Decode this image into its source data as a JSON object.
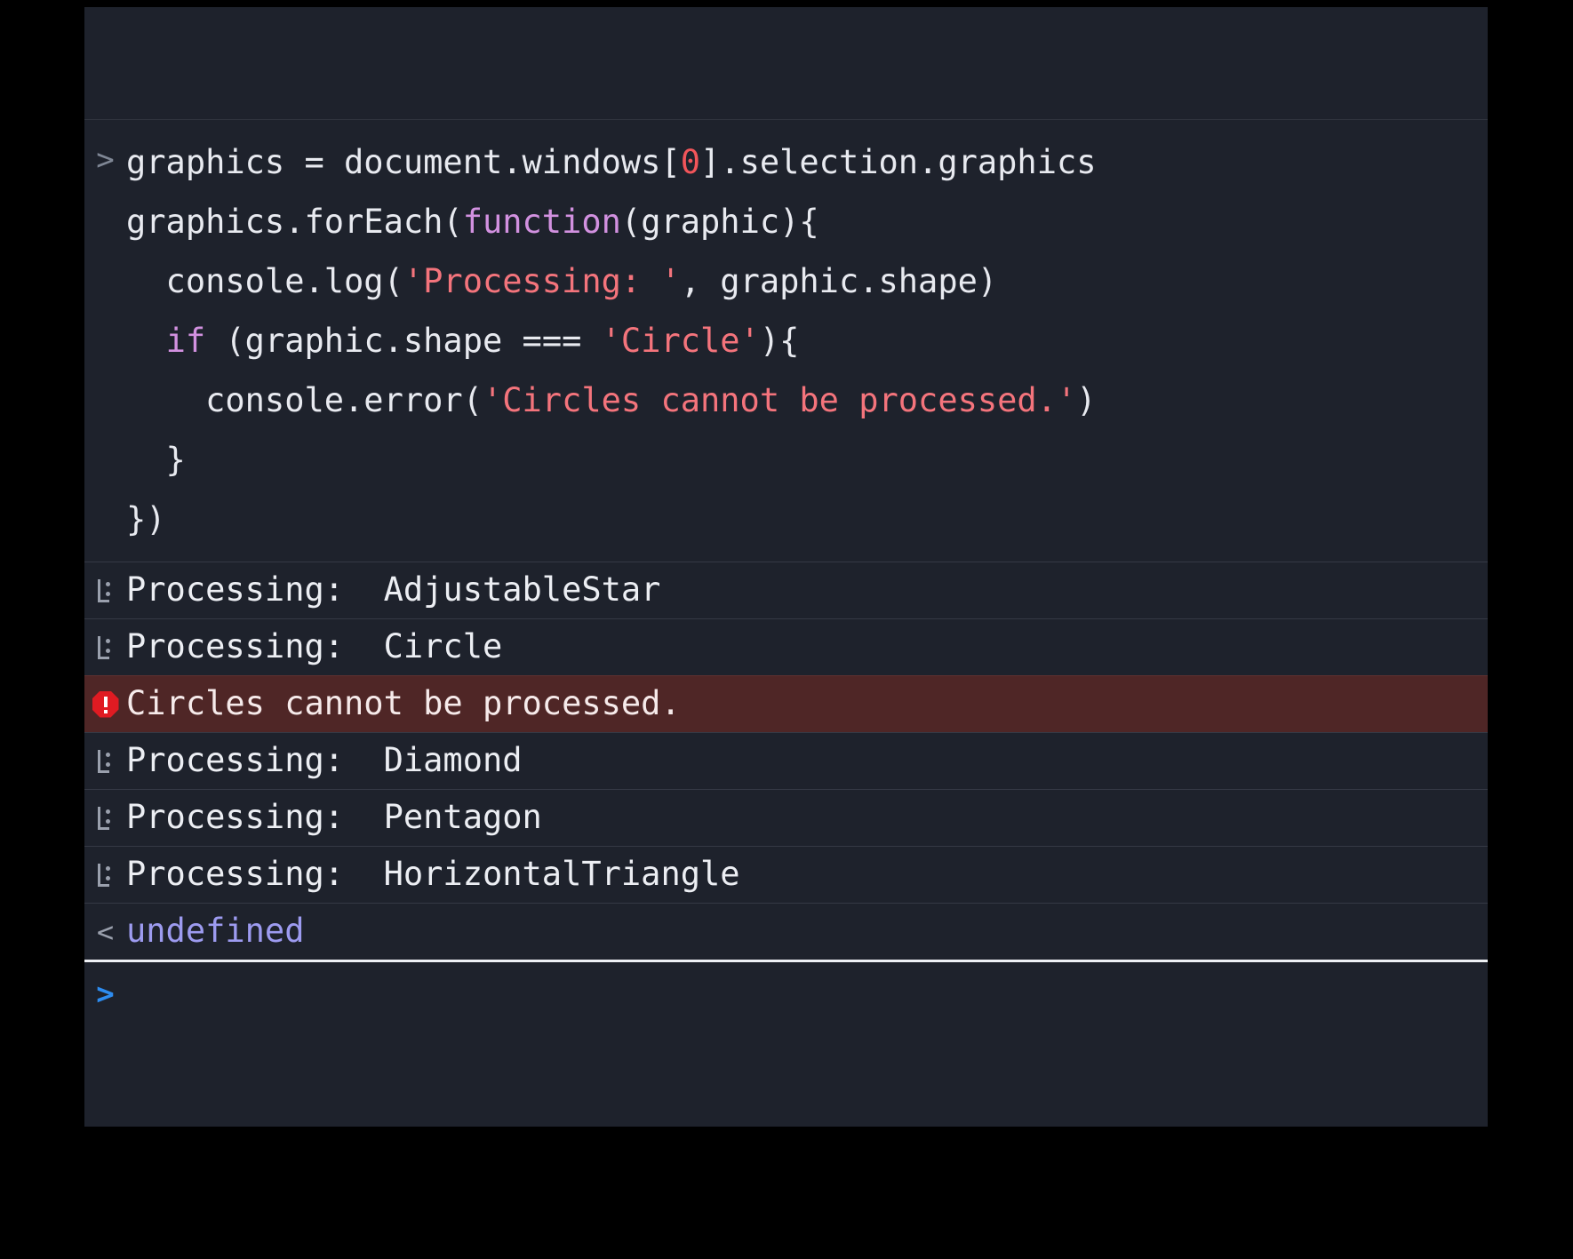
{
  "console": {
    "prompt_marker": ">",
    "result_marker": "<",
    "input_prompt_marker": ">",
    "input_placeholder": "",
    "input_value": "",
    "colors": {
      "panel_background": "#1e222c",
      "page_background": "#000000",
      "row_separator": "#353945",
      "error_row_background": "#4f2626",
      "error_icon": "#e01b22",
      "log_icon": "#9aa0ad",
      "text": "#e8eaf0",
      "string_literal": "#f4747c",
      "keyword": "#d291e0",
      "number": "#f2555a",
      "result_value": "#9d9bf0",
      "prompt_chevron": "#2d8cf0",
      "prompt_divider": "#eef0f4"
    },
    "code_lines": [
      [
        {
          "t": "graphics = document.windows[",
          "c": "plain"
        },
        {
          "t": "0",
          "c": "num"
        },
        {
          "t": "].selection.graphics",
          "c": "plain"
        }
      ],
      [
        {
          "t": "graphics.forEach(",
          "c": "plain"
        },
        {
          "t": "function",
          "c": "kw"
        },
        {
          "t": "(graphic){",
          "c": "plain"
        }
      ],
      [
        {
          "t": "  console.log(",
          "c": "plain"
        },
        {
          "t": "'Processing: '",
          "c": "str"
        },
        {
          "t": ", graphic.shape)",
          "c": "plain"
        }
      ],
      [
        {
          "t": "  ",
          "c": "plain"
        },
        {
          "t": "if",
          "c": "kw"
        },
        {
          "t": " (graphic.shape === ",
          "c": "plain"
        },
        {
          "t": "'Circle'",
          "c": "str"
        },
        {
          "t": "){",
          "c": "plain"
        }
      ],
      [
        {
          "t": "    console.error(",
          "c": "plain"
        },
        {
          "t": "'Circles cannot be processed.'",
          "c": "str"
        },
        {
          "t": ")",
          "c": "plain"
        }
      ],
      [
        {
          "t": "  }",
          "c": "plain"
        }
      ],
      [
        {
          "t": "})",
          "c": "plain"
        }
      ]
    ],
    "output_rows": [
      {
        "kind": "log",
        "icon": "console-log-icon",
        "text": "Processing:  AdjustableStar"
      },
      {
        "kind": "log",
        "icon": "console-log-icon",
        "text": "Processing:  Circle"
      },
      {
        "kind": "error",
        "icon": "console-error-icon",
        "text": "Circles cannot be processed."
      },
      {
        "kind": "log",
        "icon": "console-log-icon",
        "text": "Processing:  Diamond"
      },
      {
        "kind": "log",
        "icon": "console-log-icon",
        "text": "Processing:  Pentagon"
      },
      {
        "kind": "log",
        "icon": "console-log-icon",
        "text": "Processing:  HorizontalTriangle"
      }
    ],
    "result": {
      "value": "undefined"
    }
  }
}
